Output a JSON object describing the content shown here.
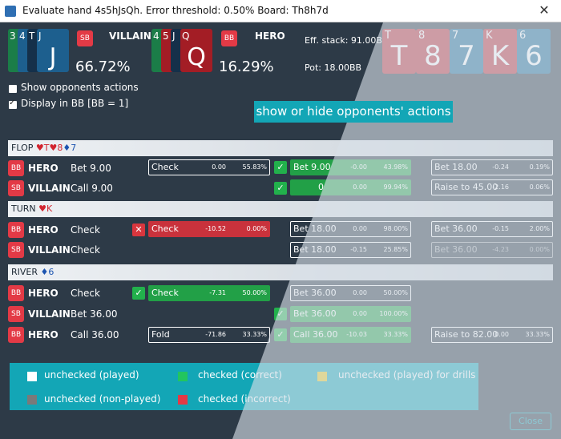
{
  "window": {
    "title": "Evaluate hand 4s5hJsQh. Error threshold: 0.50% Board: Th8h7d",
    "close_glyph": "✕"
  },
  "villain": {
    "cards": [
      {
        "rank": "3"
      },
      {
        "rank": "4"
      },
      {
        "rank": "T"
      },
      {
        "rank": "J",
        "big": "J"
      }
    ],
    "badge": "SB",
    "label": "VILLAIN",
    "pct": "66.72%"
  },
  "hero": {
    "cards": [
      {
        "rank": "4"
      },
      {
        "rank": "5"
      },
      {
        "rank": "J"
      },
      {
        "rank": "Q",
        "big": "Q"
      }
    ],
    "badge": "BB",
    "label": "HERO",
    "pct": "16.29%"
  },
  "stack": {
    "eff": "Eff. stack: 91.00BB",
    "pot": "Pot: 18.00BB"
  },
  "board": [
    {
      "rank": "T",
      "big": "T",
      "color": "red"
    },
    {
      "rank": "8",
      "big": "8",
      "color": "red"
    },
    {
      "rank": "7",
      "big": "7",
      "color": "blue"
    },
    {
      "rank": "K",
      "big": "K",
      "color": "red"
    },
    {
      "rank": "6",
      "big": "6",
      "color": "blue"
    }
  ],
  "options": {
    "show_opponents": "Show opponents actions",
    "display_bb": "Display in BB [BB = 1]"
  },
  "tooltip": "show or hide opponents' actions",
  "streets": {
    "flop": {
      "name": "FLOP",
      "c1": "♥T",
      "c2": "♥8",
      "c3": "♦7"
    },
    "turn": {
      "name": "TURN",
      "c1": "♥K"
    },
    "river": {
      "name": "RIVER",
      "c1": "♦6"
    }
  },
  "rows": [
    {
      "badge": "BB",
      "player": "HERO",
      "action": "Bet 9.00",
      "opts": [
        {
          "label": "Check",
          "ev": "0.00",
          "pct": "55.83%"
        },
        {
          "label": "Bet 9.00",
          "ev": "-0.00",
          "pct": "43.98%"
        },
        {
          "label": "Bet 18.00",
          "ev": "-0.24",
          "pct": "0.19%"
        }
      ]
    },
    {
      "badge": "SB",
      "player": "VILLAIN",
      "action": "Call 9.00",
      "opts": [
        {
          "label": "0",
          "ev": "0.00",
          "pct": "99.94%"
        },
        {
          "label": "Raise to 45.00",
          "ev": "-2.16",
          "pct": "0.06%"
        }
      ]
    },
    {
      "badge": "BB",
      "player": "HERO",
      "action": "Check",
      "marker": "✕",
      "opts": [
        {
          "label": "Check",
          "ev": "-10.52",
          "pct": "0.00%"
        },
        {
          "label": "Bet 18.00",
          "ev": "0.00",
          "pct": "98.00%"
        },
        {
          "label": "Bet 36.00",
          "ev": "-0.15",
          "pct": "2.00%"
        }
      ]
    },
    {
      "badge": "SB",
      "player": "VILLAIN",
      "action": "Check",
      "opts": [
        {
          "label": "Bet 18.00",
          "ev": "-0.15",
          "pct": "25.85%"
        },
        {
          "label": "Bet 36.00",
          "ev": "-4.23",
          "pct": "0.00%"
        }
      ]
    },
    {
      "badge": "BB",
      "player": "HERO",
      "action": "Check",
      "marker": "✓",
      "opts": [
        {
          "label": "Check",
          "ev": "-7.31",
          "pct": "50.00%"
        },
        {
          "label": "Bet 36.00",
          "ev": "0.00",
          "pct": "50.00%"
        }
      ]
    },
    {
      "badge": "SB",
      "player": "VILLAIN",
      "action": "Bet 36.00",
      "marker": "✓",
      "opts": [
        {
          "label": "Bet 36.00",
          "ev": "0.00",
          "pct": "100.00%"
        }
      ]
    },
    {
      "badge": "BB",
      "player": "HERO",
      "action": "Call 36.00",
      "marker": "✓",
      "opts": [
        {
          "label": "Fold",
          "ev": "-71.86",
          "pct": "33.33%"
        },
        {
          "label": "Call 36.00",
          "ev": "-10.03",
          "pct": "33.33%"
        },
        {
          "label": "Raise to 82.00",
          "ev": "0.00",
          "pct": "33.33%"
        }
      ]
    }
  ],
  "legend": [
    {
      "label": "unchecked (played)",
      "color": "#ffffff"
    },
    {
      "label": "checked (correct)",
      "color": "#22c55e"
    },
    {
      "label": "unchecked (played) for drills",
      "color": "#e6c81e"
    },
    {
      "label": "unchecked (non-played)",
      "color": "#7a7a7a"
    },
    {
      "label": "checked (incorrect)",
      "color": "#e33a46"
    }
  ],
  "close_button": "Close"
}
